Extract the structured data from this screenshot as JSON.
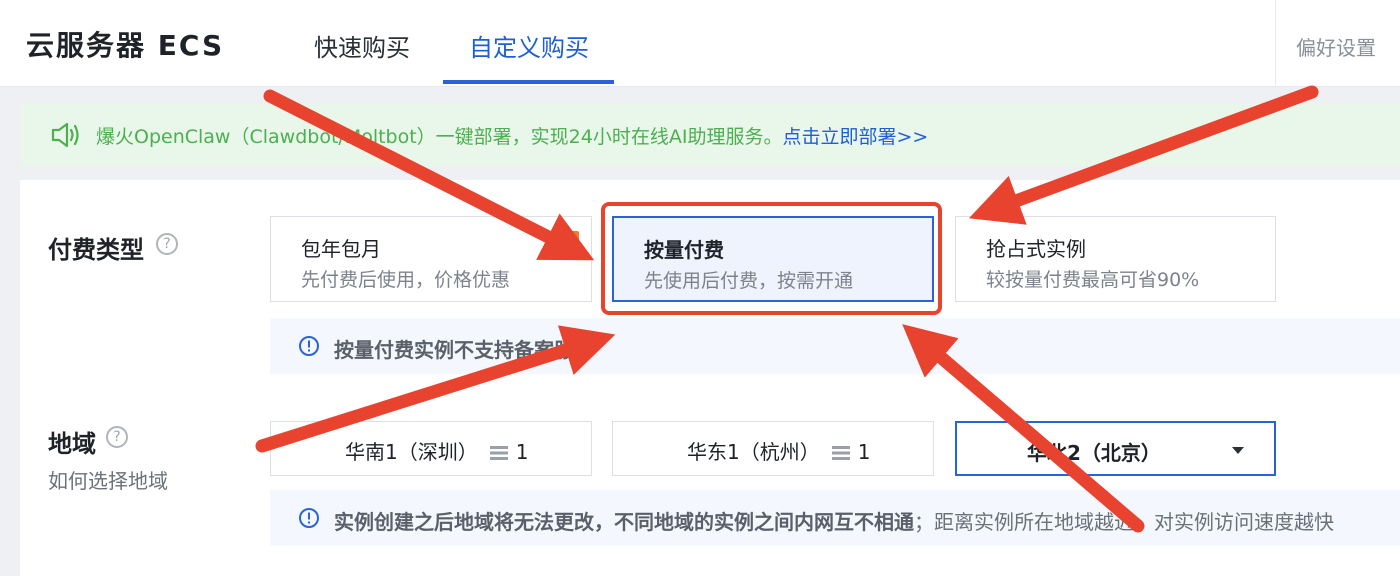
{
  "header": {
    "title": "云服务器 ECS",
    "tabs": [
      {
        "label": "快速购买",
        "active": false
      },
      {
        "label": "自定义购买",
        "active": true
      }
    ],
    "preference": "偏好设置"
  },
  "banner": {
    "icon": "speaker-icon",
    "text": "爆火OpenClaw（Clawdbot/Moltbot）一键部署，实现24小时在线AI助理服务。",
    "link": "点击立即部署>>",
    "color": "#4caf50"
  },
  "billing": {
    "label": "付费类型",
    "options": [
      {
        "title": "包年包月",
        "desc": "先付费后使用，价格优惠",
        "badge": "惠"
      },
      {
        "title": "按量付费",
        "desc": "先使用后付费，按需开通",
        "selected": true
      },
      {
        "title": "抢占式实例",
        "desc": "较按量付费最高可省90%"
      }
    ],
    "notice": "按量付费实例不支持备案服务"
  },
  "region": {
    "label": "地域",
    "help_link": "如何选择地域",
    "options": [
      {
        "name": "华南1（深圳）",
        "count": "1"
      },
      {
        "name": "华东1（杭州）",
        "count": "1"
      },
      {
        "name": "华北2（北京）",
        "selected": true
      }
    ],
    "notice_bold": "实例创建之后地域将无法更改，不同地域的实例之间内网互不相通",
    "notice_light": "；距离实例所在地域越近，对实例访问速度越快"
  },
  "colors": {
    "accent": "#2a62d8",
    "annotation": "#e8432f",
    "badge": "#ef7b2b"
  }
}
